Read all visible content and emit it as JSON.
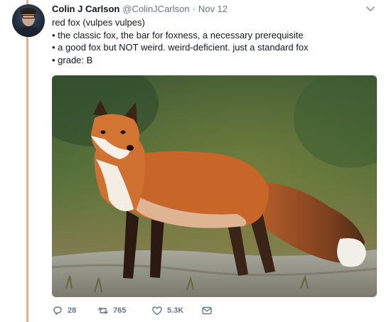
{
  "tweet": {
    "author_name": "Colin J Carlson",
    "handle": "@ColinJCarlson",
    "separator": "·",
    "date": "Nov 12",
    "lines": [
      "red fox (vulpes vulpes)",
      "• the classic fox, the bar for foxness, a necessary prerequisite",
      "• a good fox but NOT weird. weird-deficient. just a standard fox",
      "• grade: B"
    ],
    "actions": {
      "replies": "28",
      "retweets": "765",
      "likes": "5.3K"
    }
  },
  "colors": {
    "thread_line": "#f9a878",
    "text_primary": "#14171a",
    "text_secondary": "#657786"
  },
  "icons": [
    "avatar-photo",
    "chevron-down-icon",
    "reply-icon",
    "retweet-icon",
    "like-icon",
    "direct-message-icon"
  ]
}
